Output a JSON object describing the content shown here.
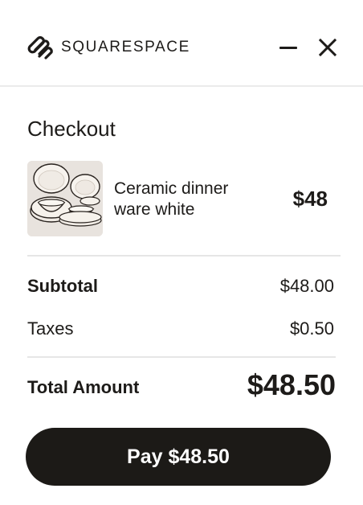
{
  "header": {
    "brand_name": "SQUARESPACE",
    "brand_icon": "squarespace-logo-icon",
    "minimize_icon": "minimize-icon",
    "close_icon": "close-icon"
  },
  "checkout": {
    "title": "Checkout",
    "items": [
      {
        "name": "Ceramic dinner ware white",
        "price": "$48",
        "image": "ceramic-dinnerware-image"
      }
    ]
  },
  "summary": {
    "subtotal_label": "Subtotal",
    "subtotal_value": "$48.00",
    "taxes_label": "Taxes",
    "taxes_value": "$0.50",
    "total_label": "Total Amount",
    "total_value": "$48.50"
  },
  "actions": {
    "pay_label": "Pay $48.50"
  },
  "colors": {
    "text": "#1d1b19",
    "button_bg": "#1c1a17",
    "button_text": "#ffffff",
    "divider": "#e6e6e6",
    "background": "#ffffff"
  }
}
